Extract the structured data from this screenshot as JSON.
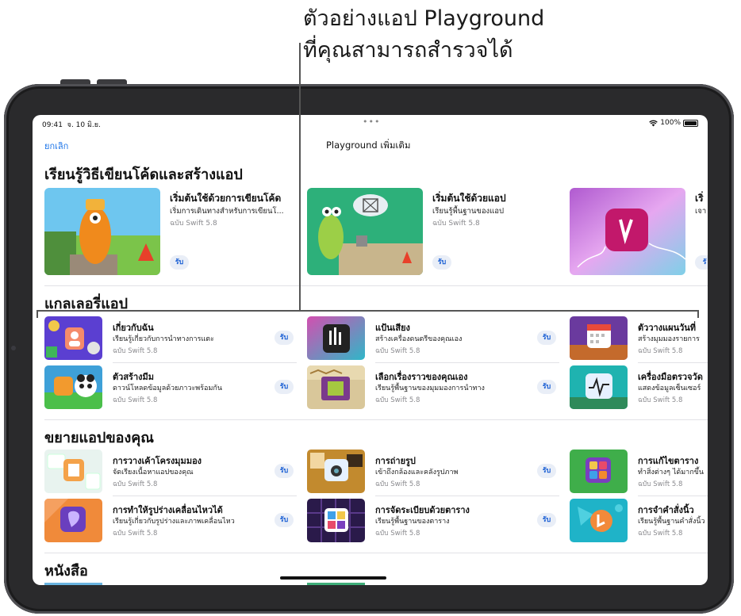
{
  "callout": {
    "line1": "ตัวอย่างแอป Playground",
    "line2": "ที่คุณสามารถสำรวจได้"
  },
  "status_bar": {
    "time": "09:41",
    "date": "จ. 10 มิ.ย.",
    "battery": "100%"
  },
  "nav": {
    "cancel_label": "ยกเลิก",
    "title": "Playground เพิ่มเติม"
  },
  "sections": {
    "learn": {
      "title": "เรียนรู้วิธีเขียนโค้ดและสร้างแอป",
      "items": [
        {
          "title": "เริ่มต้นใช้ด้วยการเขียนโค้ด",
          "subtitle": "เริ่มการเดินทางสำหรับการเขียนโ...",
          "version": "ฉบับ Swift 5.8",
          "button": "รับ"
        },
        {
          "title": "เริ่มต้นใช้ด้วยแอป",
          "subtitle": "เรียนรู้พื้นฐานของแอป",
          "version": "ฉบับ Swift 5.8",
          "button": "รับ"
        },
        {
          "title": "เริ่",
          "subtitle": "เจา",
          "version": "",
          "button": "รั"
        }
      ]
    },
    "gallery": {
      "title": "แกลเลอรี่แอป",
      "items": [
        {
          "title": "เกี่ยวกับฉัน",
          "subtitle": "เรียนรู้เกี่ยวกับการนำทางการแตะ",
          "version": "ฉบับ Swift 5.8",
          "button": "รับ"
        },
        {
          "title": "แป้นเสียง",
          "subtitle": "สร้างเครื่องดนตรีของคุณเอง",
          "version": "ฉบับ Swift 5.8",
          "button": "รับ"
        },
        {
          "title": "ตัววางแผนวันที่",
          "subtitle": "สร้างมุมมองรายการ",
          "version": "ฉบับ Swift 5.8",
          "button": ""
        },
        {
          "title": "ตัวสร้างมีม",
          "subtitle": "ดาวน์โหลดข้อมูลด้วยภาวะพร้อมกัน",
          "version": "ฉบับ Swift 5.8",
          "button": "รับ"
        },
        {
          "title": "เลือกเรื่องราวของคุณเอง",
          "subtitle": "เรียนรู้พื้นฐานของมุมมองการนำทาง",
          "version": "ฉบับ Swift 5.8",
          "button": "รับ"
        },
        {
          "title": "เครื่องมือตรวจวัด",
          "subtitle": "แสดงข้อมูลเซ็นเซอร์",
          "version": "ฉบับ Swift 5.8",
          "button": ""
        }
      ]
    },
    "extend": {
      "title": "ขยายแอปของคุณ",
      "items": [
        {
          "title": "การวางเค้าโครงมุมมอง",
          "subtitle": "จัดเรียงเนื้อหาแอปของคุณ",
          "version": "ฉบับ Swift 5.8",
          "button": "รับ"
        },
        {
          "title": "การถ่ายรูป",
          "subtitle": "เข้าถึงกล้องและคลังรูปภาพ",
          "version": "ฉบับ Swift 5.8",
          "button": "รับ"
        },
        {
          "title": "การแก้ไขตาราง",
          "subtitle": "ทำสิ่งต่างๆ ได้มากขึ้น",
          "version": "ฉบับ Swift 5.8",
          "button": ""
        },
        {
          "title": "การทำให้รูปร่างเคลื่อนไหวได้",
          "subtitle": "เรียนรู้เกี่ยวกับรูปร่างและภาพเคลื่อนไหว",
          "version": "ฉบับ Swift 5.8",
          "button": "รับ"
        },
        {
          "title": "การจัดระเบียบด้วยตาราง",
          "subtitle": "เรียนรู้พื้นฐานของตาราง",
          "version": "ฉบับ Swift 5.8",
          "button": "รับ"
        },
        {
          "title": "การจำคำสั่งนิ้ว",
          "subtitle": "เรียนรู้พื้นฐานคำสั่งนิ้ว",
          "version": "ฉบับ Swift 5.8",
          "button": ""
        }
      ]
    },
    "books": {
      "title": "หนังสือ"
    }
  }
}
